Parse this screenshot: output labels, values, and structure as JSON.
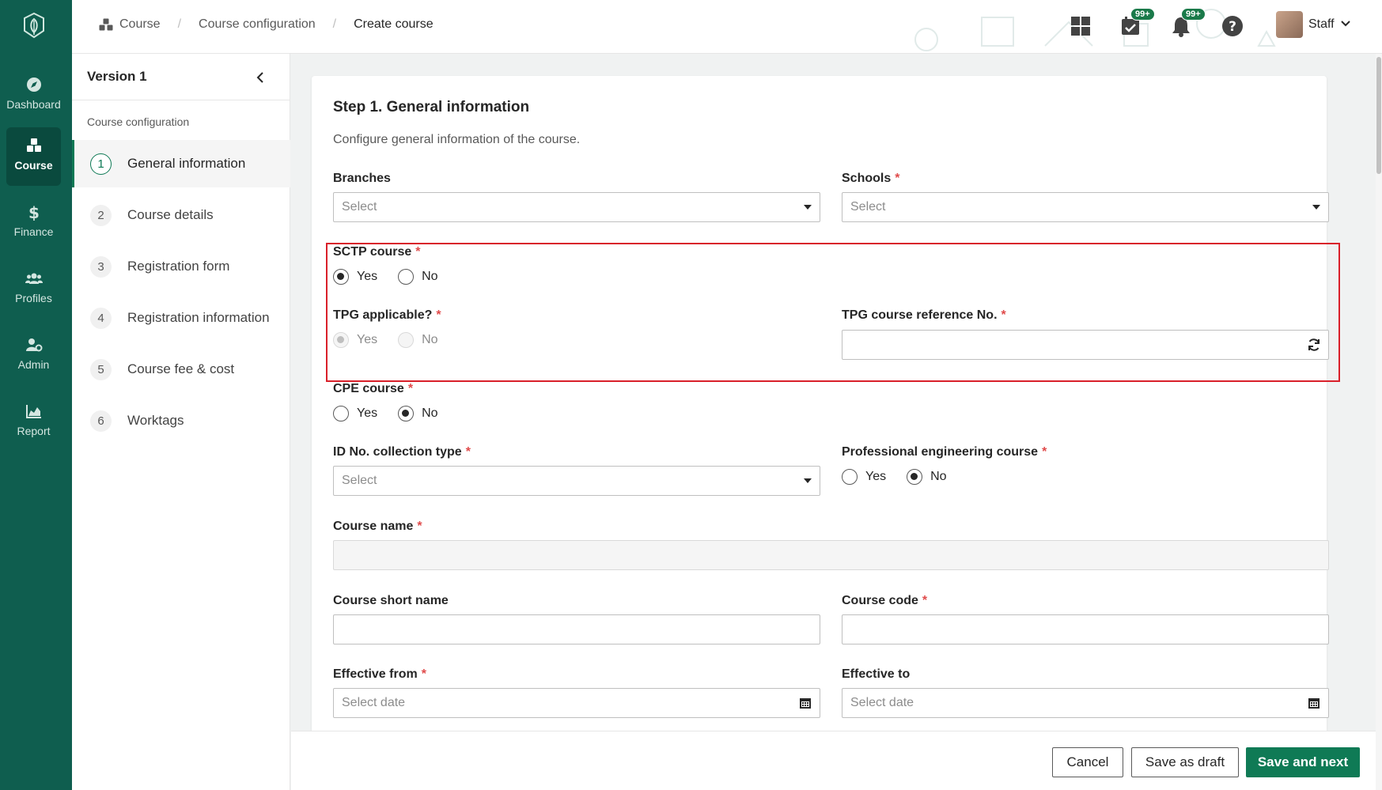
{
  "nav": {
    "items": [
      {
        "label": "Dashboard",
        "icon": "compass-icon"
      },
      {
        "label": "Course",
        "icon": "cubes-icon",
        "active": true
      },
      {
        "label": "Finance",
        "icon": "dollar-icon"
      },
      {
        "label": "Profiles",
        "icon": "users-icon"
      },
      {
        "label": "Admin",
        "icon": "user-gear-icon"
      },
      {
        "label": "Report",
        "icon": "chart-area-icon"
      }
    ]
  },
  "header": {
    "breadcrumb": [
      "Course",
      "Course configuration",
      "Create course"
    ],
    "tasks_badge": "99+",
    "notifications_badge": "99+",
    "user_name": "Staff"
  },
  "steps_panel": {
    "version": "Version 1",
    "heading": "Course configuration",
    "steps": [
      {
        "num": "1",
        "label": "General information",
        "active": true
      },
      {
        "num": "2",
        "label": "Course details"
      },
      {
        "num": "3",
        "label": "Registration form"
      },
      {
        "num": "4",
        "label": "Registration information"
      },
      {
        "num": "5",
        "label": "Course fee & cost"
      },
      {
        "num": "6",
        "label": "Worktags"
      }
    ]
  },
  "form": {
    "title": "Step 1. General information",
    "subtitle": "Configure general information of the course.",
    "branches": {
      "label": "Branches",
      "placeholder": "Select"
    },
    "schools": {
      "label": "Schools",
      "placeholder": "Select"
    },
    "sctp": {
      "label": "SCTP course",
      "yes": "Yes",
      "no": "No",
      "value": "Yes"
    },
    "tpg": {
      "label": "TPG applicable?",
      "yes": "Yes",
      "no": "No",
      "value": "Yes"
    },
    "tpg_ref": {
      "label": "TPG course reference No.",
      "value": ""
    },
    "cpe": {
      "label": "CPE course",
      "yes": "Yes",
      "no": "No",
      "value": "No"
    },
    "id_type": {
      "label": "ID No. collection type",
      "placeholder": "Select"
    },
    "prof_eng": {
      "label": "Professional engineering course",
      "yes": "Yes",
      "no": "No",
      "value": "No"
    },
    "course_name": {
      "label": "Course name",
      "value": ""
    },
    "short_name": {
      "label": "Course short name",
      "value": ""
    },
    "course_code": {
      "label": "Course code",
      "value": ""
    },
    "effective_from": {
      "label": "Effective from",
      "placeholder": "Select date"
    },
    "effective_to": {
      "label": "Effective to",
      "placeholder": "Select date"
    }
  },
  "footer": {
    "cancel": "Cancel",
    "save_draft": "Save as draft",
    "save_next": "Save and next"
  },
  "colors": {
    "brand": "#0f5e4f",
    "primary": "#0f7a55",
    "highlight": "#d9202a",
    "required": "#e04a4a"
  }
}
